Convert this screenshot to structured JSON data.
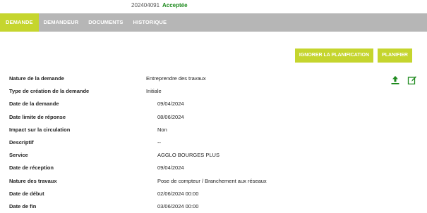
{
  "header": {
    "reference": "202404091",
    "status": "Acceptée",
    "status_color": "#1e8a1e"
  },
  "tabs": [
    {
      "label": "DEMANDE",
      "active": true
    },
    {
      "label": "DEMANDEUR",
      "active": false
    },
    {
      "label": "DOCUMENTS",
      "active": false
    },
    {
      "label": "HISTORIQUE",
      "active": false
    }
  ],
  "actions": {
    "ignore_label": "IGNORER LA PLANIFICATION",
    "plan_label": "PLANIFIER",
    "accent_color": "#c5d52e"
  },
  "icons": {
    "upload": "upload-icon",
    "edit": "edit-icon"
  },
  "fields": [
    {
      "label": "Nature de la demande",
      "value": "Entreprendre des travaux"
    },
    {
      "label": "Type de création de la demande",
      "value": "Initiale"
    },
    {
      "label": "Date de la demande",
      "value": "09/04/2024"
    },
    {
      "label": "Date limite de réponse",
      "value": "08/06/2024"
    },
    {
      "label": "Impact sur la circulation",
      "value": "Non"
    },
    {
      "label": "Descriptif",
      "value": "--"
    },
    {
      "label": "Service",
      "value": "AGGLO BOURGES PLUS"
    },
    {
      "label": "Date de réception",
      "value": "09/04/2024"
    },
    {
      "label": "Nature des travaux",
      "value": "Pose de compteur / Branchement aux réseaux"
    },
    {
      "label": "Date de début",
      "value": "02/06/2024 00:00"
    },
    {
      "label": "Date de fin",
      "value": "03/06/2024 00:00"
    }
  ]
}
